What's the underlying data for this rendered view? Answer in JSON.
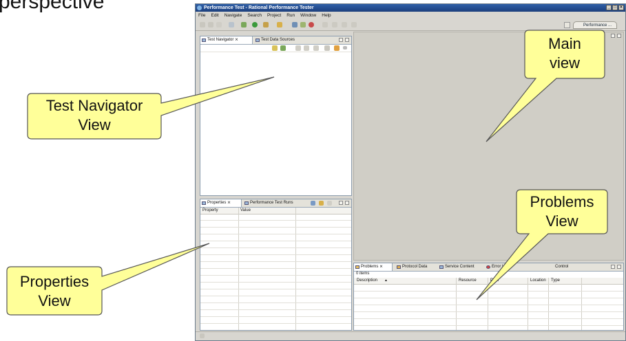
{
  "slide": {
    "title": "perspective"
  },
  "window": {
    "title": "Performance Test - Rational Performance Tester"
  },
  "menu": [
    "File",
    "Edit",
    "Navigate",
    "Search",
    "Project",
    "Run",
    "Window",
    "Help"
  ],
  "perspective_button": "Performance ...",
  "navigator_pane": {
    "tabs": [
      "Test Navigator",
      "Test Data Sources"
    ]
  },
  "properties_pane": {
    "tabs": [
      "Properties",
      "Performance Test Runs"
    ],
    "columns": [
      "Property",
      "Value"
    ]
  },
  "problems_pane": {
    "tabs": [
      "Problems",
      "Protocol Data",
      "Service Content",
      "Error Log",
      "Control"
    ],
    "items_count": "0 items",
    "columns": [
      "Description",
      "Resource",
      "Path",
      "Location",
      "Type"
    ]
  },
  "callouts": {
    "main_view": [
      "Main",
      "view"
    ],
    "navigator_view": [
      "Test Navigator",
      "View"
    ],
    "problems_view": [
      "Problems",
      "View"
    ],
    "properties_view": [
      "Properties",
      "View"
    ]
  },
  "colors": {
    "callout_fill": "#ffff99",
    "title_bar": "#2f5fa8"
  }
}
